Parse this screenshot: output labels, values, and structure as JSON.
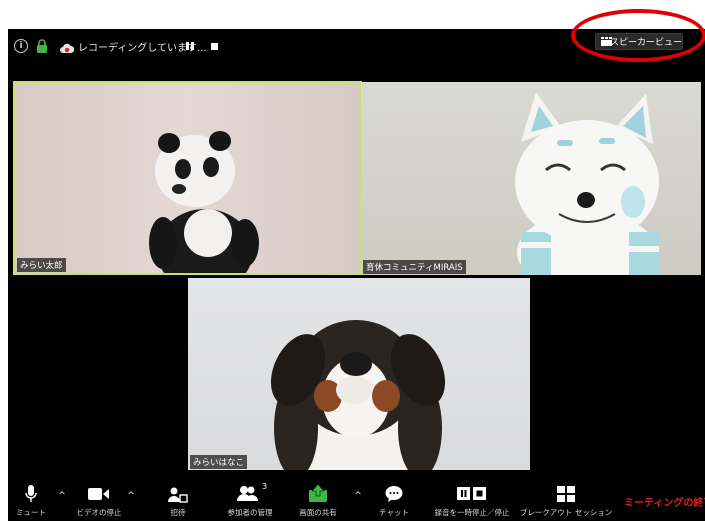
{
  "topbar": {
    "recording_text": "レコーディングしています...",
    "speaker_view_label": "スピーカービュー"
  },
  "tiles": [
    {
      "name": "みらい太郎",
      "active_speaker": true
    },
    {
      "name": "育休コミュニティMIRAIS",
      "active_speaker": false
    },
    {
      "name": "みらいはなこ",
      "active_speaker": false
    }
  ],
  "toolbar": {
    "mute": "ミュート",
    "video_stop": "ビデオの停止",
    "invite": "招待",
    "participants": "参加者の管理",
    "participants_count": "3",
    "share_screen": "画面の共有",
    "chat": "チャット",
    "recording_control": "録音を一時停止／停止",
    "breakout": "ブレークアウト セッション",
    "end_meeting": "ミーティングの終了"
  },
  "colors": {
    "active_border": "#c7e26d",
    "share_green": "#3fb843",
    "end_red": "#e02020",
    "annotation_red": "#e10000"
  }
}
